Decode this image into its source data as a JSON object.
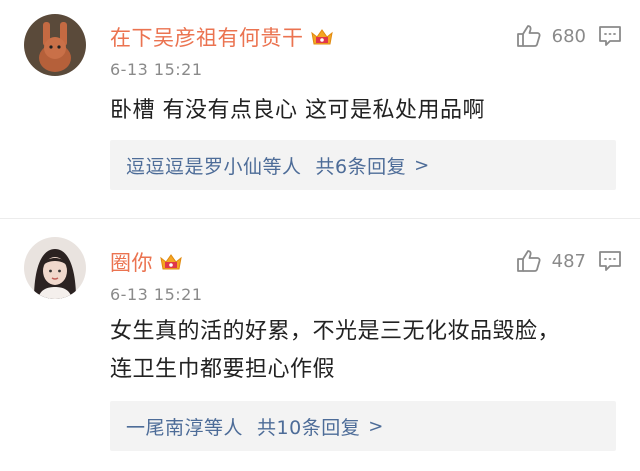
{
  "comments": [
    {
      "username": "在下吴彦祖有何贵干",
      "timestamp": "6-13 15:21",
      "likes": "680",
      "content": "卧槽 有没有点良心 这可是私处用品啊",
      "replies": {
        "who": "逗逗逗是罗小仙等人",
        "count": "共6条回复",
        "chevron": ">"
      }
    },
    {
      "username": "圈你",
      "timestamp": "6-13 15:21",
      "likes": "487",
      "content": "女生真的活的好累，不光是三无化妆品毁脸，连卫生巾都要担心作假",
      "replies": {
        "who": "一尾南淳等人",
        "count": "共10条回复",
        "chevron": ">"
      }
    }
  ],
  "icons": {
    "like": "thumbs-up-icon",
    "comment": "comment-icon",
    "badge": "crown-vip-icon"
  },
  "colors": {
    "username": "#eb7350",
    "reply_link": "#4d6c98",
    "reply_bg": "#f3f3f3",
    "meta": "#8a8a8a"
  }
}
